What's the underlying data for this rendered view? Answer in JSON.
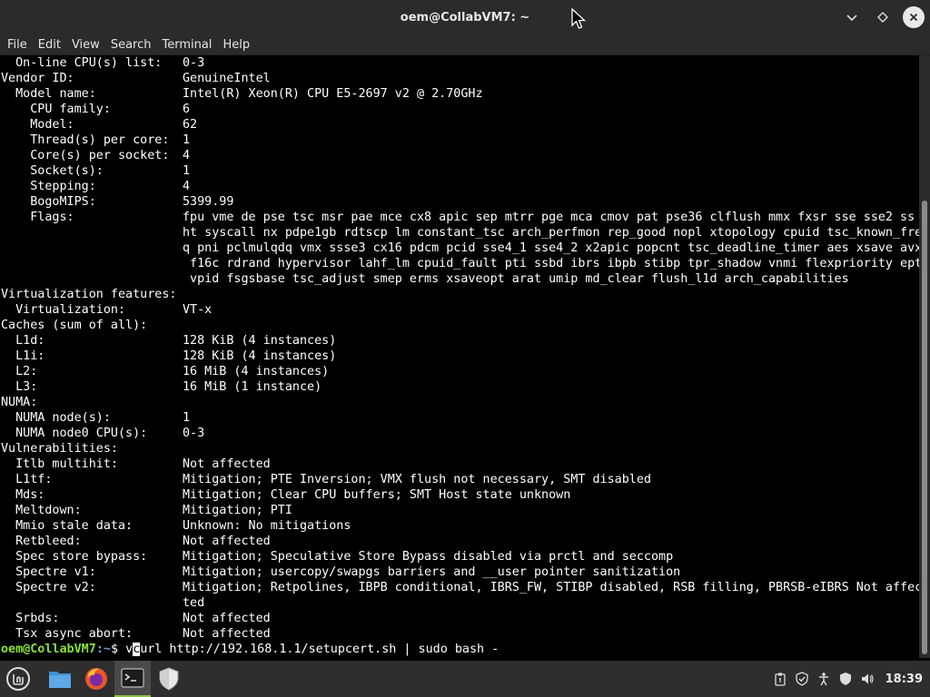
{
  "window": {
    "title": "oem@CollabVM7: ~"
  },
  "menu": {
    "file": "File",
    "edit": "Edit",
    "view": "View",
    "search": "Search",
    "terminal": "Terminal",
    "help": "Help"
  },
  "terminal": {
    "lines": [
      [
        "  On-line CPU(s) list:",
        "0-3"
      ],
      [
        "Vendor ID:",
        "GenuineIntel"
      ],
      [
        "  Model name:",
        "Intel(R) Xeon(R) CPU E5-2697 v2 @ 2.70GHz"
      ],
      [
        "    CPU family:",
        "6"
      ],
      [
        "    Model:",
        "62"
      ],
      [
        "    Thread(s) per core:",
        "1"
      ],
      [
        "    Core(s) per socket:",
        "4"
      ],
      [
        "    Socket(s):",
        "1"
      ],
      [
        "    Stepping:",
        "4"
      ],
      [
        "    BogoMIPS:",
        "5399.99"
      ],
      [
        "    Flags:",
        "fpu vme de pse tsc msr pae mce cx8 apic sep mtrr pge mca cmov pat pse36 clflush mmx fxsr sse sse2 ss"
      ],
      [
        "",
        "ht syscall nx pdpe1gb rdtscp lm constant_tsc arch_perfmon rep_good nopl xtopology cpuid tsc_known_fre"
      ],
      [
        "",
        "q pni pclmulqdq vmx ssse3 cx16 pdcm pcid sse4_1 sse4_2 x2apic popcnt tsc_deadline_timer aes xsave avx"
      ],
      [
        "",
        " f16c rdrand hypervisor lahf_lm cpuid_fault pti ssbd ibrs ibpb stibp tpr_shadow vnmi flexpriority ept"
      ],
      [
        "",
        " vpid fsgsbase tsc_adjust smep erms xsaveopt arat umip md_clear flush_l1d arch_capabilities"
      ],
      [
        "Virtualization features:",
        ""
      ],
      [
        "  Virtualization:",
        "VT-x"
      ],
      [
        "Caches (sum of all):",
        ""
      ],
      [
        "  L1d:",
        "128 KiB (4 instances)"
      ],
      [
        "  L1i:",
        "128 KiB (4 instances)"
      ],
      [
        "  L2:",
        "16 MiB (4 instances)"
      ],
      [
        "  L3:",
        "16 MiB (1 instance)"
      ],
      [
        "NUMA:",
        ""
      ],
      [
        "  NUMA node(s):",
        "1"
      ],
      [
        "  NUMA node0 CPU(s):",
        "0-3"
      ],
      [
        "Vulnerabilities:",
        ""
      ],
      [
        "  Itlb multihit:",
        "Not affected"
      ],
      [
        "  L1tf:",
        "Mitigation; PTE Inversion; VMX flush not necessary, SMT disabled"
      ],
      [
        "  Mds:",
        "Mitigation; Clear CPU buffers; SMT Host state unknown"
      ],
      [
        "  Meltdown:",
        "Mitigation; PTI"
      ],
      [
        "  Mmio stale data:",
        "Unknown: No mitigations"
      ],
      [
        "  Retbleed:",
        "Not affected"
      ],
      [
        "  Spec store bypass:",
        "Mitigation; Speculative Store Bypass disabled via prctl and seccomp"
      ],
      [
        "  Spectre v1:",
        "Mitigation; usercopy/swapgs barriers and __user pointer sanitization"
      ],
      [
        "  Spectre v2:",
        "Mitigation; Retpolines, IBPB conditional, IBRS_FW, STIBP disabled, RSB filling, PBRSB-eIBRS Not affec"
      ],
      [
        "",
        "ted"
      ],
      [
        "  Srbds:",
        "Not affected"
      ],
      [
        "  Tsx async abort:",
        "Not affected"
      ]
    ],
    "prompt_user": "oem@CollabVM7",
    "prompt_path": ":~",
    "prompt_symbol": "$ ",
    "command_before_cursor": "v",
    "cursor_char": "c",
    "command_after_cursor": "url http://192.168.1.1/setupcert.sh | sudo bash -"
  },
  "taskbar": {
    "clock": "18:39"
  },
  "colors": {
    "prompt_user": "#8ae234",
    "prompt_path": "#729fcf",
    "mint_green": "#8fbf4a"
  }
}
